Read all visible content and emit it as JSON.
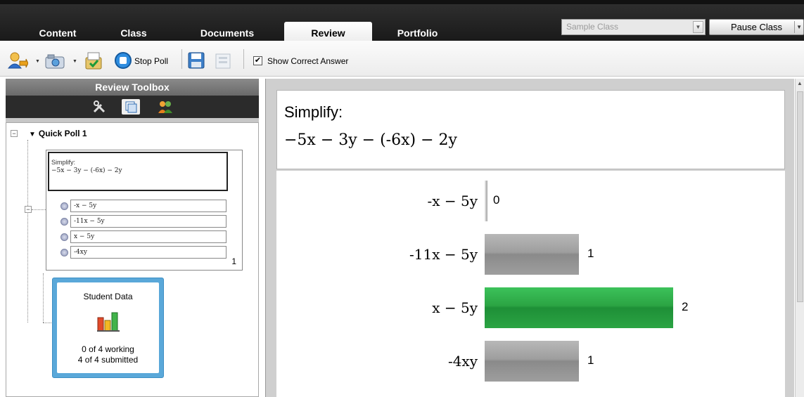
{
  "tabs": [
    {
      "label": "Content",
      "active": false
    },
    {
      "label": "Class",
      "active": false
    },
    {
      "label": "Documents",
      "active": false
    },
    {
      "label": "Review",
      "active": true
    },
    {
      "label": "Portfolio",
      "active": false
    }
  ],
  "class_select": {
    "value": "Sample Class"
  },
  "pause_class": {
    "label": "Pause Class"
  },
  "toolbar": {
    "stop_poll_label": "Stop Poll",
    "show_correct_answer": {
      "label": "Show Correct Answer",
      "checked": true
    }
  },
  "toolbox": {
    "header": "Review Toolbox",
    "icons": [
      "tools-icon",
      "pages-icon",
      "students-icon"
    ],
    "active_icon": "pages-icon"
  },
  "tree": {
    "poll_title": "Quick Poll 1",
    "thumbnail": {
      "question_line1": "Simplify:",
      "question_line2": "−5x − 3y − (-6x) − 2y",
      "options": [
        "-x − 5y",
        "-11x − 5y",
        "x − 5y",
        "-4xy"
      ],
      "count": "1"
    },
    "student_data": {
      "title": "Student Data",
      "working": "0 of 4 working",
      "submitted": "4 of 4 submitted"
    }
  },
  "question": {
    "title": "Simplify:",
    "expression": "−5x − 3y − (-6x) − 2y"
  },
  "results": {
    "max": 2,
    "rows": [
      {
        "label": "-x − 5y",
        "count": 0,
        "color": "#9e9e9e",
        "correct": false
      },
      {
        "label": "-11x − 5y",
        "count": 1,
        "color": "#9e9e9e",
        "correct": false
      },
      {
        "label": "x − 5y",
        "count": 2,
        "color": "#2ba443",
        "correct": true
      },
      {
        "label": "-4xy",
        "count": 1,
        "color": "#9e9e9e",
        "correct": false
      }
    ]
  }
}
